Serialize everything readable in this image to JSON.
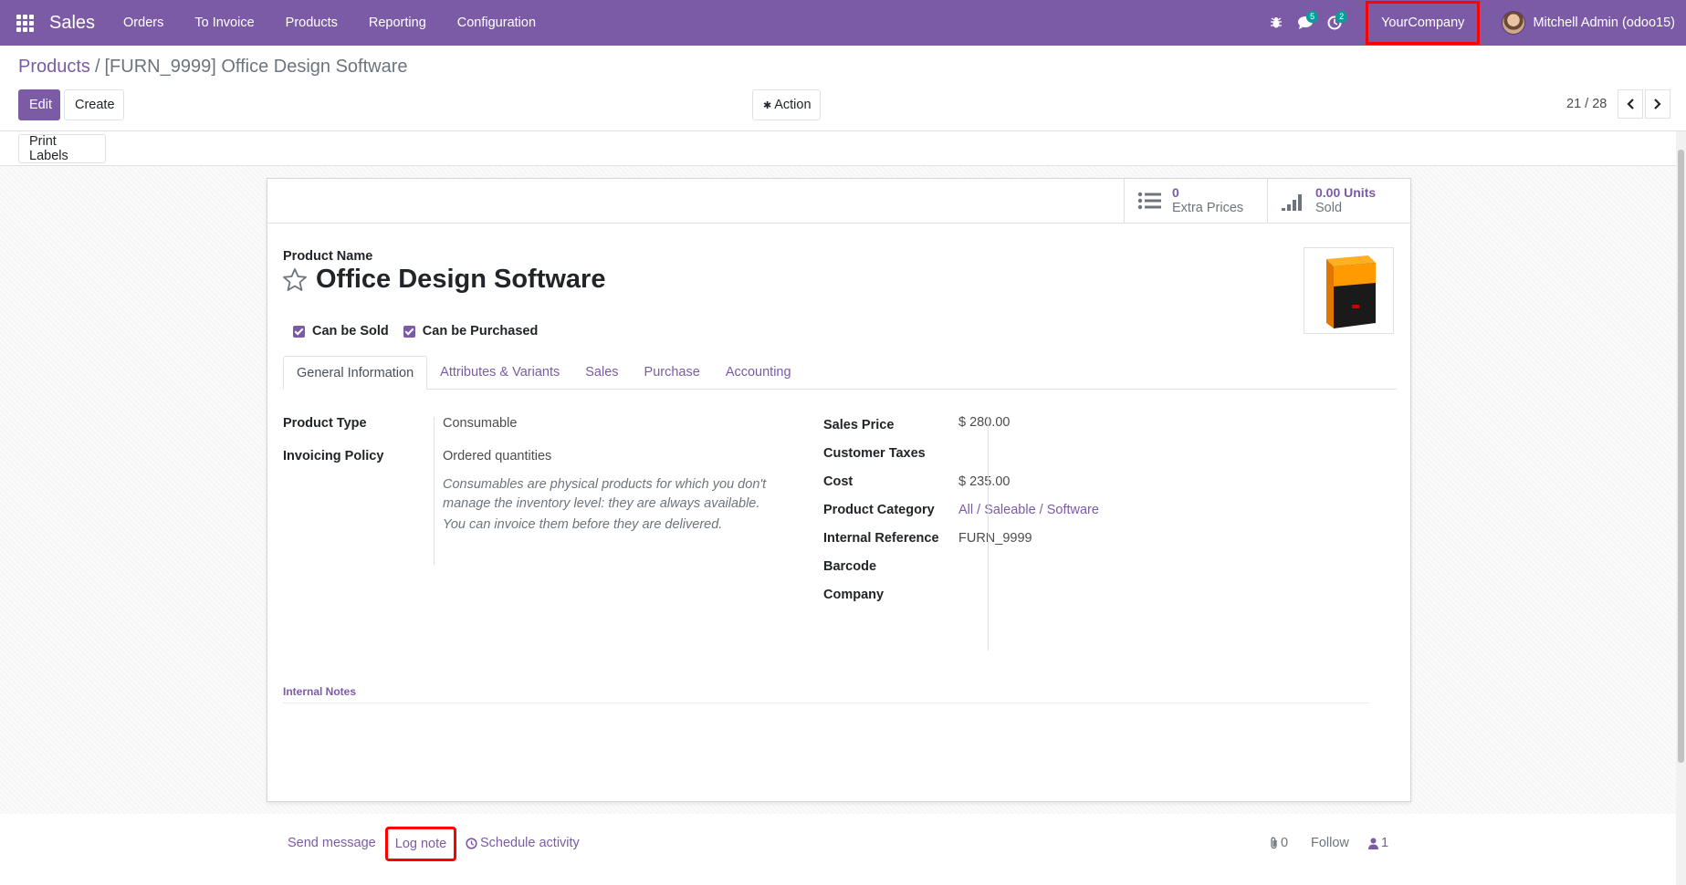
{
  "navbar": {
    "app_title": "Sales",
    "menu": [
      "Orders",
      "To Invoice",
      "Products",
      "Reporting",
      "Configuration"
    ],
    "messages_badge": "5",
    "activities_badge": "2",
    "company": "YourCompany",
    "user": "Mitchell Admin (odoo15)"
  },
  "breadcrumb": {
    "parent": "Products",
    "separator": "/",
    "current": "[FURN_9999] Office Design Software"
  },
  "buttons": {
    "edit": "Edit",
    "create": "Create",
    "action": "Action",
    "print_labels": "Print Labels"
  },
  "pager": {
    "value": "21 / 28"
  },
  "stats": {
    "extra_prices_value": "0",
    "extra_prices_label": "Extra Prices",
    "sold_value": "0.00 Units",
    "sold_label": "Sold"
  },
  "product": {
    "name_label": "Product Name",
    "name": "Office Design Software",
    "can_be_sold": "Can be Sold",
    "can_be_purchased": "Can be Purchased",
    "image_icon": "software-box-icon"
  },
  "tabs": [
    "General Information",
    "Attributes & Variants",
    "Sales",
    "Purchase",
    "Accounting"
  ],
  "general": {
    "left": [
      {
        "label": "Product Type",
        "value": "Consumable"
      },
      {
        "label": "Invoicing Policy",
        "value": "Ordered quantities"
      }
    ],
    "help_1": "Consumables are physical products for which you don't manage the inventory level: they are always available.",
    "help_2": "You can invoice them before they are delivered.",
    "right": [
      {
        "label": "Sales Price",
        "value": "$ 280.00"
      },
      {
        "label": "Customer Taxes",
        "value": ""
      },
      {
        "label": "Cost",
        "value": "$ 235.00"
      },
      {
        "label": "Product Category",
        "value": "All / Saleable / Software"
      },
      {
        "label": "Internal Reference",
        "value": "FURN_9999"
      },
      {
        "label": "Barcode",
        "value": ""
      },
      {
        "label": "Company",
        "value": ""
      }
    ],
    "internal_notes_label": "Internal Notes"
  },
  "chatter": {
    "send_message": "Send message",
    "log_note": "Log note",
    "schedule_activity": "Schedule activity",
    "attachments_count": "0",
    "follow": "Follow",
    "followers_count": "1"
  },
  "colors": {
    "brand": "#7c5ba6",
    "badge": "#00a09d",
    "highlight": "#ff0000"
  }
}
